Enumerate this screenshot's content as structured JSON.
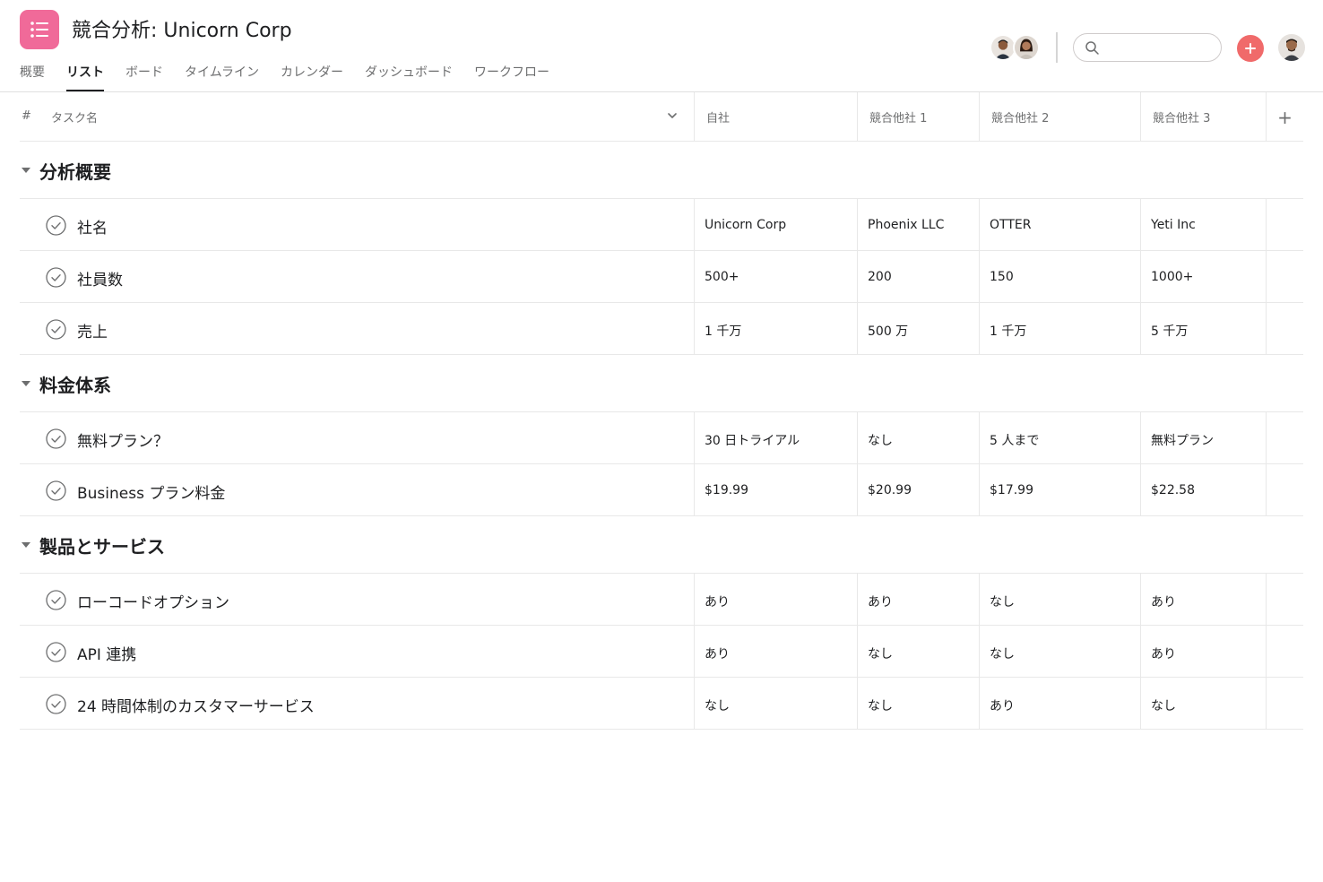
{
  "header": {
    "title": "競合分析: Unicorn Corp",
    "search_placeholder": ""
  },
  "tabs": [
    {
      "label": "概要",
      "active": false
    },
    {
      "label": "リスト",
      "active": true
    },
    {
      "label": "ボード",
      "active": false
    },
    {
      "label": "タイムライン",
      "active": false
    },
    {
      "label": "カレンダー",
      "active": false
    },
    {
      "label": "ダッシュボード",
      "active": false
    },
    {
      "label": "ワークフロー",
      "active": false
    }
  ],
  "columns": {
    "hash": "#",
    "task": "タスク名",
    "c1": "自社",
    "c2": "競合他社 1",
    "c3": "競合他社 2",
    "c4": "競合他社 3",
    "add": "+"
  },
  "sections": [
    {
      "title": "分析概要",
      "rows": [
        {
          "name": "社名",
          "values": [
            "Unicorn Corp",
            "Phoenix LLC",
            "OTTER",
            "Yeti Inc"
          ]
        },
        {
          "name": "社員数",
          "values": [
            "500+",
            "200",
            "150",
            "1000+"
          ]
        },
        {
          "name": "売上",
          "values": [
            "1 千万",
            "500 万",
            "1 千万",
            "5 千万"
          ]
        }
      ]
    },
    {
      "title": "料金体系",
      "rows": [
        {
          "name": "無料プラン？",
          "values": [
            "30 日トライアル",
            "なし",
            "5 人まで",
            "無料プラン"
          ]
        },
        {
          "name": "Business プラン料金",
          "values": [
            "$19.99",
            "$20.99",
            "$17.99",
            "$22.58"
          ]
        }
      ]
    },
    {
      "title": "製品とサービス",
      "rows": [
        {
          "name": "ローコードオプション",
          "values": [
            "あり",
            "あり",
            "なし",
            "あり"
          ]
        },
        {
          "name": "API 連携",
          "values": [
            "あり",
            "なし",
            "なし",
            "あり"
          ]
        },
        {
          "name": "24 時間体制のカスタマーサービス",
          "values": [
            "なし",
            "なし",
            "あり",
            "なし"
          ]
        }
      ]
    }
  ],
  "colors": {
    "app_icon": "#f06a99",
    "add_button": "#f06a6a",
    "text": "#1e1f21",
    "muted": "#6d6e6f",
    "border": "#e8e8e8"
  }
}
